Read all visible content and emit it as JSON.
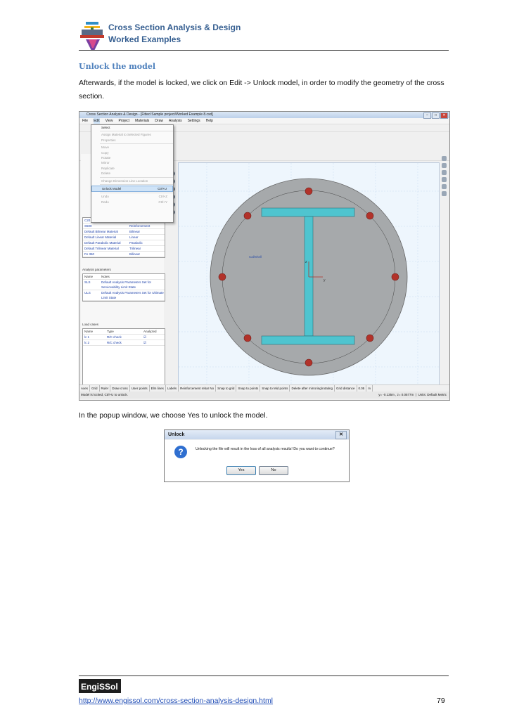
{
  "header": {
    "title_line1": "Cross Section Analysis & Design",
    "title_line2": "Worked Examples"
  },
  "section_heading": "Unlock the model",
  "paragraph1": "Afterwards, if the model is locked, we click on Edit -> Unlock model, in order to modify the geometry of the cross section.",
  "paragraph2": "In the popup window, we choose Yes to unlock the model.",
  "screenshot": {
    "window_title": "Cross Section Analysis & Design - [Fitted Sample project/Worked Example 8.csd]",
    "menu": [
      "File",
      "Edit",
      "View",
      "Project",
      "Materials",
      "Draw",
      "Analysis",
      "Settings",
      "Help"
    ],
    "edit_menu": [
      {
        "label": "Select",
        "shortcut": "",
        "disabled": false,
        "selected": false
      },
      {
        "label": "Assign Material to Selected Figures",
        "shortcut": "",
        "disabled": true,
        "selected": false
      },
      {
        "label": "Properties",
        "shortcut": "",
        "disabled": true,
        "selected": false
      },
      {
        "label": "Move",
        "shortcut": "",
        "disabled": true,
        "selected": false
      },
      {
        "label": "Copy",
        "shortcut": "",
        "disabled": true,
        "selected": false
      },
      {
        "label": "Rotate",
        "shortcut": "",
        "disabled": true,
        "selected": false
      },
      {
        "label": "Mirror",
        "shortcut": "",
        "disabled": true,
        "selected": false
      },
      {
        "label": "Replicate",
        "shortcut": "",
        "disabled": true,
        "selected": false
      },
      {
        "label": "Delete",
        "shortcut": "",
        "disabled": true,
        "selected": false
      },
      {
        "label": "Change Dimension Line Location",
        "shortcut": "",
        "disabled": true,
        "selected": false
      },
      {
        "label": "Unlock Model",
        "shortcut": "Ctrl+U",
        "disabled": false,
        "selected": true
      },
      {
        "label": "Undo",
        "shortcut": "Ctrl+Z",
        "disabled": true,
        "selected": false
      },
      {
        "label": "Redo",
        "shortcut": "Ctrl+Y",
        "disabled": true,
        "selected": false
      }
    ],
    "materials": [
      {
        "name": "C20",
        "type": "Concrete"
      },
      {
        "name": "S500",
        "type": "Reinforcement"
      },
      {
        "name": "Default Bilinear Material",
        "type": "Bilinear"
      },
      {
        "name": "Default Linear Material",
        "type": "Linear"
      },
      {
        "name": "Default Parabolic Material",
        "type": "Parabolic"
      },
      {
        "name": "Default Trilinear Material",
        "type": "Trilinear"
      },
      {
        "name": "Fe 360",
        "type": "Bilinear"
      }
    ],
    "analysis_parameters_title": "Analysis parameters",
    "analysis_parameters_headers": [
      "Name",
      "Notes"
    ],
    "analysis_parameters": [
      {
        "name": "SLS",
        "notes": "Default Analysis Parameters Set for Serviceability Limit State"
      },
      {
        "name": "ULS",
        "notes": "Default Analysis Parameters Set for Ultimate Limit State"
      }
    ],
    "load_cases_title": "Load cases",
    "load_cases_headers": [
      "Name",
      "Type",
      "Analyzed"
    ],
    "load_cases": [
      {
        "name": "lc 1",
        "type": "R/C check",
        "analyzed": "☑"
      },
      {
        "name": "lc 2",
        "type": "R/C check",
        "analyzed": "☑"
      }
    ],
    "bottom_toggles": [
      "Axes",
      "Grid",
      "Ruler",
      "Draw cross",
      "User points",
      "Elm lines",
      "Labels",
      "Reinforcement rebar No",
      "Snap to grid",
      "Snap to points",
      "Snap to Mid points",
      "Delete after mirroring/rotating",
      "Grid distance",
      "0.05",
      "m"
    ],
    "status_left": "Model is locked, Ctrl+U to unlock.",
    "status_coords": "y= -0.135m , z= 0.0577m",
    "status_units": "Units: Default Metric",
    "axis_y": "y",
    "axis_z": "z",
    "shape_label": "Cal/Shell"
  },
  "popup": {
    "title": "Unlock",
    "close": "✕",
    "message": "Unlocking the file will result in the loss of all analysis results! Do you want to continue?",
    "yes": "Yes",
    "no": "No"
  },
  "footer": {
    "url": "http://www.engissol.com/cross-section-analysis-design.html",
    "page_number": "79",
    "logo_text": "EngiSSol"
  },
  "colors": {
    "heading": "#4f81bd",
    "section_fill": "#a6a9ab",
    "steel_fill": "#4fc4cf",
    "rebar_fill": "#b2322a"
  }
}
